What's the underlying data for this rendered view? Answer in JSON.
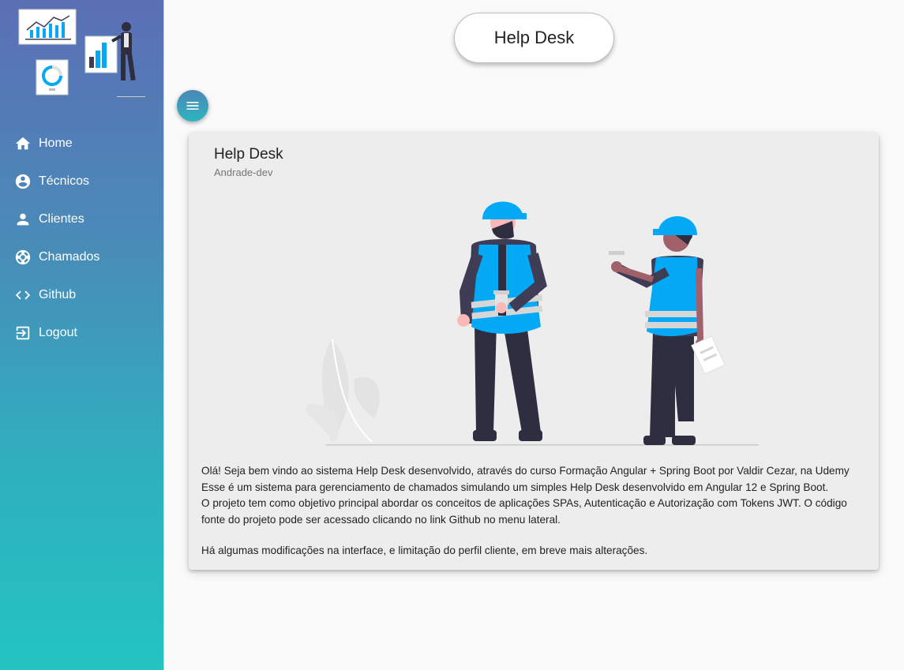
{
  "sidebar": {
    "items": [
      {
        "label": "Home",
        "icon": "home-icon"
      },
      {
        "label": "Técnicos",
        "icon": "account-circle-icon"
      },
      {
        "label": "Clientes",
        "icon": "person-icon"
      },
      {
        "label": "Chamados",
        "icon": "support-icon"
      },
      {
        "label": "Github",
        "icon": "code-icon"
      },
      {
        "label": "Logout",
        "icon": "logout-icon"
      }
    ]
  },
  "header": {
    "title": "Help Desk"
  },
  "card": {
    "title": "Help Desk",
    "subtitle": "Andrade-dev",
    "paragraphs": [
      "Olá! Seja bem vindo ao sistema Help Desk desenvolvido, através do curso Formação Angular + Spring Boot por Valdir Cezar, na Udemy",
      "Esse é um sistema para gerenciamento de chamados simulando um simples Help Desk desenvolvido em Angular 12 e Spring Boot.",
      "O projeto tem como objetivo principal abordar os conceitos de aplicações SPAs, Autenticação e Autorização com Tokens JWT. O código fonte do projeto pode ser acessado clicando no link Github no menu lateral.",
      "Há algumas modificações na interface, e limitação do perfil cliente, em breve mais alterações."
    ]
  },
  "colors": {
    "sidebar_top": "#5b6fb5",
    "sidebar_bottom": "#23c4c2",
    "accent": "#03a9f4"
  }
}
